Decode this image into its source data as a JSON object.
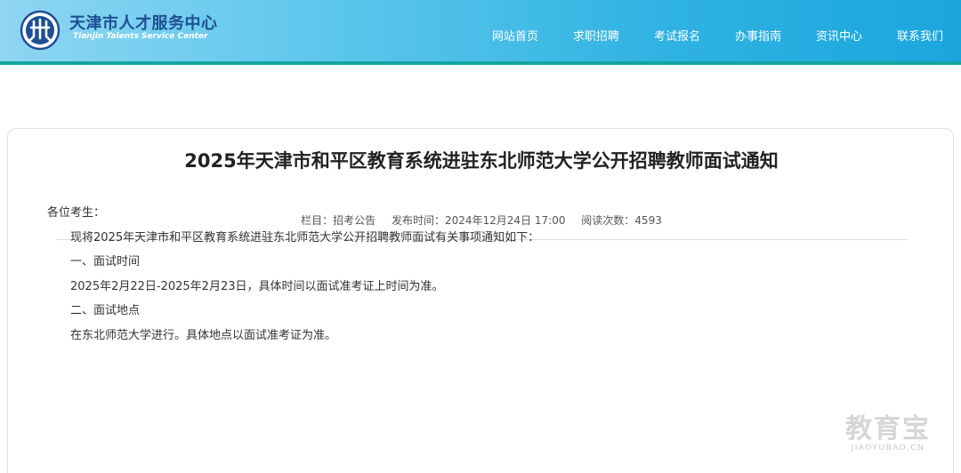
{
  "header": {
    "logo_cn": "天津市人才服务中心",
    "logo_en": "Tianjin Talents Service Center",
    "logo_icon": "tianjin-talents-emblem"
  },
  "nav": {
    "items": [
      {
        "label": "网站首页"
      },
      {
        "label": "求职招聘"
      },
      {
        "label": "考试报名"
      },
      {
        "label": "办事指南"
      },
      {
        "label": "资讯中心"
      },
      {
        "label": "联系我们"
      }
    ]
  },
  "article": {
    "title": "2025年天津市和平区教育系统进驻东北师范大学公开招聘教师面试通知",
    "meta": {
      "column": "栏目：招考公告",
      "published": "发布时间：2024年12月24日 17:00",
      "views": "阅读次数：4593"
    },
    "paragraphs": [
      "各位考生：",
      "现将2025年天津市和平区教育系统进驻东北师范大学公开招聘教师面试有关事项通知如下：",
      "一、面试时间",
      "2025年2月22日-2025年2月23日，具体时间以面试准考证上时间为准。",
      "二、面试地点",
      "在东北师范大学进行。具体地点以面试准考证为准。"
    ]
  },
  "watermark": {
    "cn": "教育宝",
    "en": "JIAOYUBAO.CN"
  },
  "colors": {
    "header_start": "#8fd6f2",
    "header_end": "#1aa6dd",
    "header_border": "#13a5a0",
    "logo_text": "#1f4f93"
  }
}
